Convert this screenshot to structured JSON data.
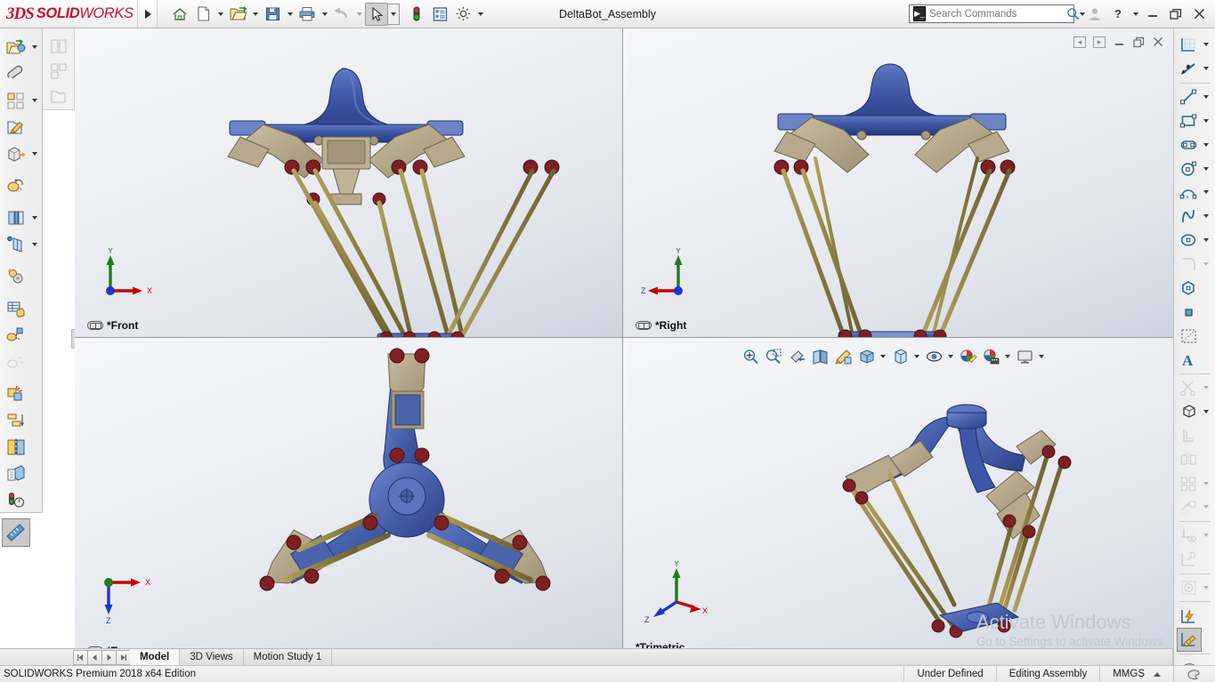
{
  "app": {
    "brand_ds": "3DS",
    "brand_solid": "SOLID",
    "brand_works": "WORKS",
    "document_title": "DeltaBot_Assembly",
    "edition": "SOLIDWORKS Premium 2018 x64 Edition"
  },
  "search": {
    "placeholder": "Search Commands",
    "value": ""
  },
  "titlebar": {
    "menu_expand": "menu-expand-arrow",
    "buttons": [
      {
        "name": "home-button",
        "label": "Home"
      },
      {
        "name": "new-document-button",
        "label": "New"
      },
      {
        "name": "open-document-button",
        "label": "Open"
      },
      {
        "name": "save-button",
        "label": "Save"
      },
      {
        "name": "print-button",
        "label": "Print"
      },
      {
        "name": "undo-button",
        "label": "Undo"
      },
      {
        "name": "select-button",
        "label": "Select"
      },
      {
        "name": "rebuild-button",
        "label": "Rebuild"
      },
      {
        "name": "options-list-button",
        "label": "File Properties"
      },
      {
        "name": "settings-button",
        "label": "Options"
      }
    ],
    "window_controls": [
      {
        "name": "user-account-icon",
        "glyph": "person"
      },
      {
        "name": "help-button",
        "glyph": "?"
      },
      {
        "name": "minimize-button",
        "glyph": "minimize"
      },
      {
        "name": "restore-button",
        "glyph": "restore"
      },
      {
        "name": "close-button",
        "glyph": "close"
      }
    ]
  },
  "left_toolbar": {
    "items": [
      {
        "name": "edit-component-button",
        "label": "Edit Component",
        "caret": true
      },
      {
        "name": "insert-components-button",
        "label": "Insert Components",
        "caret": false
      },
      {
        "name": "linear-component-pattern-button",
        "label": "Linear Component Pattern",
        "caret": true
      },
      {
        "name": "smart-fasteners-button",
        "label": "Smart Fasteners",
        "caret": false
      },
      {
        "name": "move-component-button",
        "label": "Move Component",
        "caret": true
      },
      {
        "name": "show-hidden-components-button",
        "label": "Show Hidden Components",
        "caret": false
      },
      {
        "name": "assembly-features-button",
        "label": "Assembly Features",
        "caret": true
      },
      {
        "name": "reference-geometry-button",
        "label": "Reference Geometry",
        "caret": true
      },
      {
        "name": "new-motion-study-button",
        "label": "New Motion Study",
        "caret": false
      },
      {
        "name": "bill-of-materials-button",
        "label": "Bill of Materials",
        "caret": false
      },
      {
        "name": "exploded-view-button",
        "label": "Exploded View",
        "caret": false
      },
      {
        "name": "explode-line-sketch-button",
        "label": "Explode Line Sketch",
        "caret": false
      },
      {
        "name": "interference-detection-button",
        "label": "Interference Detection",
        "caret": false
      },
      {
        "name": "clearance-verification-button",
        "label": "Clearance Verification",
        "caret": false
      },
      {
        "name": "hole-alignment-button",
        "label": "Hole Alignment",
        "caret": false
      },
      {
        "name": "assembly-visualization-button",
        "label": "Assembly Visualization",
        "caret": false
      },
      {
        "name": "performance-evaluation-button",
        "label": "Performance Evaluation",
        "caret": false
      },
      {
        "name": "measure-button",
        "label": "Measure",
        "caret": false,
        "selected": true
      }
    ],
    "secondary_items": [
      {
        "name": "mate-button",
        "label": "Mate"
      },
      {
        "name": "linear-pattern-grey-button",
        "label": "Linear Pattern"
      },
      {
        "name": "smart-fasteners-grey-button",
        "label": "Smart Fasteners"
      }
    ]
  },
  "right_toolbar": {
    "items": [
      {
        "name": "sketch-button",
        "label": "Sketch",
        "caret": true,
        "dim": false
      },
      {
        "name": "edit-sketch-button",
        "label": "Edit Sketch",
        "caret": true,
        "dim": false
      },
      {
        "name": "line-tool-button",
        "label": "Line",
        "caret": true,
        "dim": false
      },
      {
        "name": "rectangle-tool-button",
        "label": "Corner Rectangle",
        "caret": true,
        "dim": false
      },
      {
        "name": "slot-tool-button",
        "label": "Straight Slot",
        "caret": true,
        "dim": false
      },
      {
        "name": "circle-tool-button",
        "label": "Circle",
        "caret": true,
        "dim": false
      },
      {
        "name": "arc-tool-button",
        "label": "Centerpoint Arc",
        "caret": true,
        "dim": false
      },
      {
        "name": "spline-tool-button",
        "label": "Spline",
        "caret": true,
        "dim": false
      },
      {
        "name": "ellipse-tool-button",
        "label": "Ellipse",
        "caret": true,
        "dim": false
      },
      {
        "name": "fillet-tool-button",
        "label": "Sketch Fillet",
        "caret": true,
        "dim": true
      },
      {
        "name": "polygon-tool-button",
        "label": "Polygon",
        "caret": false,
        "dim": false
      },
      {
        "name": "point-tool-button",
        "label": "Point",
        "caret": false,
        "dim": false
      },
      {
        "name": "construction-geometry-button",
        "label": "Construction Geometry",
        "caret": false,
        "dim": false
      },
      {
        "name": "text-tool-button",
        "label": "Text",
        "caret": false,
        "dim": false
      },
      {
        "name": "trim-entities-button",
        "label": "Trim Entities",
        "caret": true,
        "dim": true
      },
      {
        "name": "convert-entities-button",
        "label": "Convert Entities",
        "caret": true,
        "dim": false
      },
      {
        "name": "offset-entities-button",
        "label": "Offset Entities",
        "caret": false,
        "dim": true
      },
      {
        "name": "mirror-entities-button",
        "label": "Mirror Entities",
        "caret": false,
        "dim": true
      },
      {
        "name": "linear-sketch-pattern-button",
        "label": "Linear Sketch Pattern",
        "caret": true,
        "dim": true
      },
      {
        "name": "move-entities-button",
        "label": "Move Entities",
        "caret": true,
        "dim": true
      },
      {
        "name": "display-delete-relations-button",
        "label": "Display/Delete Relations",
        "caret": true,
        "dim": true
      },
      {
        "name": "repair-sketch-button",
        "label": "Repair Sketch",
        "caret": false,
        "dim": true
      },
      {
        "name": "quick-snaps-button",
        "label": "Quick Snaps",
        "caret": true,
        "dim": true
      },
      {
        "name": "rapid-sketch-button",
        "label": "Rapid Sketch",
        "caret": false,
        "dim": false
      },
      {
        "name": "smart-dimension-button",
        "label": "Smart Dimension",
        "caret": false,
        "dim": false,
        "selected": true
      },
      {
        "name": "appearance-button",
        "label": "Appearances",
        "caret": false,
        "dim": false
      }
    ]
  },
  "viewport_toolbar": {
    "items": [
      {
        "name": "zoom-to-fit-button",
        "label": "Zoom to Fit",
        "caret": false
      },
      {
        "name": "zoom-to-area-button",
        "label": "Zoom to Area",
        "caret": false
      },
      {
        "name": "previous-view-button",
        "label": "Previous View",
        "caret": false
      },
      {
        "name": "section-view-button",
        "label": "Section View",
        "caret": false
      },
      {
        "name": "view-orientation-button",
        "label": "View Orientation",
        "caret": false
      },
      {
        "name": "view-orientation-cube-button",
        "label": "View Orientation",
        "caret": true
      },
      {
        "name": "display-style-button",
        "label": "Display Style",
        "caret": true
      },
      {
        "name": "hide-show-items-button",
        "label": "Hide/Show Items",
        "caret": true
      },
      {
        "name": "edit-appearance-button",
        "label": "Edit Appearance",
        "caret": false
      },
      {
        "name": "apply-scene-button",
        "label": "Apply Scene",
        "caret": true
      },
      {
        "name": "view-settings-button",
        "label": "View Settings",
        "caret": true
      }
    ],
    "window_controls": [
      {
        "name": "vp-prev-button",
        "glyph": "left"
      },
      {
        "name": "vp-next-button",
        "glyph": "right"
      },
      {
        "name": "vp-minimize-button",
        "glyph": "minimize"
      },
      {
        "name": "vp-restore-button",
        "glyph": "restore"
      },
      {
        "name": "vp-close-button",
        "glyph": "close"
      }
    ]
  },
  "viewports": [
    {
      "name": "viewport-front",
      "label": "*Front",
      "linked": true,
      "triad": "front"
    },
    {
      "name": "viewport-right",
      "label": "*Right",
      "linked": true,
      "triad": "right"
    },
    {
      "name": "viewport-top",
      "label": "*Top",
      "linked": true,
      "triad": "top"
    },
    {
      "name": "viewport-trimetric",
      "label": "*Trimetric",
      "linked": false,
      "triad": "trimetric"
    }
  ],
  "triad_axes": {
    "x": "X",
    "y": "Y",
    "z": "Z"
  },
  "tabs": {
    "nav_buttons": [
      "first",
      "prev",
      "next",
      "last"
    ],
    "items": [
      {
        "name": "tab-model",
        "label": "Model",
        "active": true
      },
      {
        "name": "tab-3d-views",
        "label": "3D Views",
        "active": false
      },
      {
        "name": "tab-motion-study-1",
        "label": "Motion Study 1",
        "active": false
      }
    ]
  },
  "statusbar": {
    "left": "SOLIDWORKS Premium 2018 x64 Edition",
    "cells": [
      {
        "name": "status-under-defined",
        "label": "Under Defined"
      },
      {
        "name": "status-editing-assembly",
        "label": "Editing Assembly"
      },
      {
        "name": "status-units",
        "label": "MMGS"
      }
    ]
  },
  "watermark": {
    "title": "Activate Windows",
    "subtitle": "Go to Settings to activate Windows."
  },
  "colors": {
    "brand_red": "#c8102e",
    "model_blue": "#3a55a0",
    "model_tan": "#b3a384",
    "model_rod": "#9a8a4a",
    "joint_red": "#7d1f23",
    "axis_x": "#cc0000",
    "axis_y": "#1f7a1f",
    "axis_z": "#1f35cc"
  }
}
